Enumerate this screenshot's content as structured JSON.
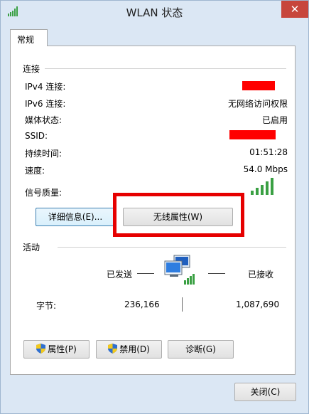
{
  "window": {
    "title": "WLAN 状态"
  },
  "tabs": [
    {
      "label": "常规"
    }
  ],
  "connection": {
    "section_label": "连接",
    "rows": [
      {
        "label": "IPv4 连接:",
        "value": ""
      },
      {
        "label": "IPv6 连接:",
        "value": "无网络访问权限"
      },
      {
        "label": "媒体状态:",
        "value": "已启用"
      },
      {
        "label": "SSID:",
        "value": ""
      },
      {
        "label": "持续时间:",
        "value": "01:51:28"
      },
      {
        "label": "速度:",
        "value": "54.0 Mbps"
      },
      {
        "label": "信号质量:",
        "value": ""
      }
    ],
    "signal_bars": 5,
    "buttons": {
      "details": "详细信息(E)...",
      "wireless": "无线属性(W)"
    }
  },
  "activity": {
    "section_label": "活动",
    "sent_label": "已发送",
    "received_label": "已接收",
    "bytes_label": "字节:",
    "bytes_sent": "236,166",
    "bytes_received": "1,087,690"
  },
  "buttons": {
    "properties": "属性(P)",
    "disable": "禁用(D)",
    "diagnose": "诊断(G)",
    "close": "关闭(C)"
  },
  "colors": {
    "redaction": "#ff0000",
    "highlight": "#e60000",
    "signal": "#3aa043"
  },
  "icons": [
    "wifi-signal-icon",
    "close-icon",
    "network-computers-icon",
    "uac-shield-icon"
  ]
}
